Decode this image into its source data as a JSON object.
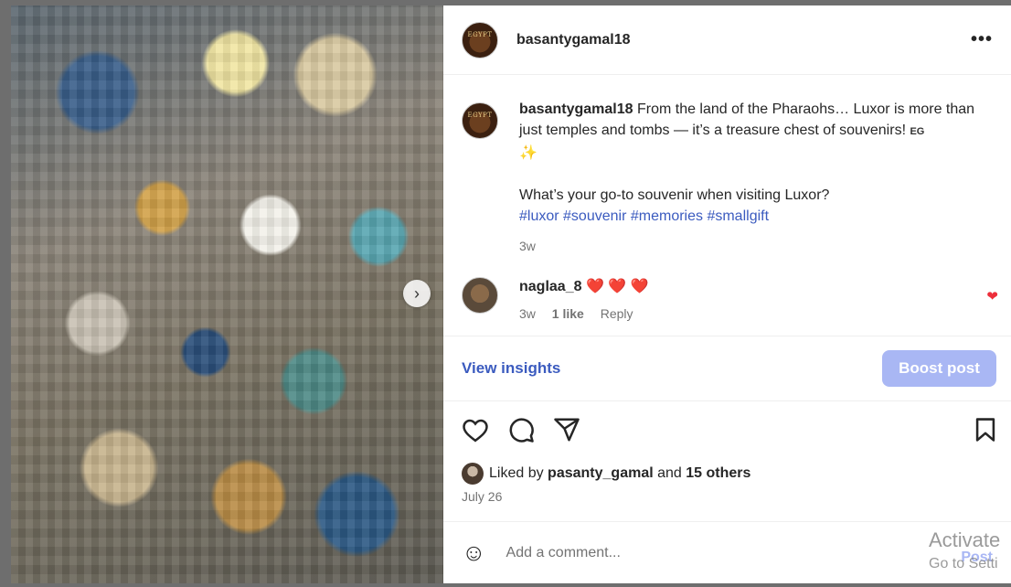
{
  "post": {
    "username": "basantygamal18",
    "avatar_text": "EGYPT",
    "more_label": "•••",
    "caption": {
      "user": "basantygamal18",
      "text": "From the land of the Pharaohs… Luxor is more than just temples and tombs — it’s a treasure chest of souvenirs!",
      "flag": "EG",
      "sparkle": "✨",
      "question": "What’s your go-to souvenir when visiting Luxor?",
      "hashtags": [
        "#luxor",
        "#souvenir",
        "#memories",
        "#smallgift"
      ],
      "time": "3w"
    },
    "comment": {
      "user": "naglaa_8",
      "hearts": "❤️ ❤️ ❤️",
      "time": "3w",
      "likes": "1 like",
      "reply": "Reply",
      "liked_icon": "heart-filled"
    },
    "insights": {
      "view_label": "View insights",
      "boost_label": "Boost post"
    },
    "liked_by": {
      "prefix": "Liked by",
      "user": "pasanty_gamal",
      "conj": "and",
      "others": "15 others"
    },
    "date": "July 26",
    "add_comment": {
      "placeholder": "Add a comment...",
      "post_label": "Post"
    }
  },
  "overlay": {
    "activate_line1": "Activate",
    "activate_line2": "Go to Setti"
  },
  "colors": {
    "link_blue": "#3b5bbf",
    "boost_bg": "#a9b7f4",
    "heart_red": "#ed2f3b"
  }
}
